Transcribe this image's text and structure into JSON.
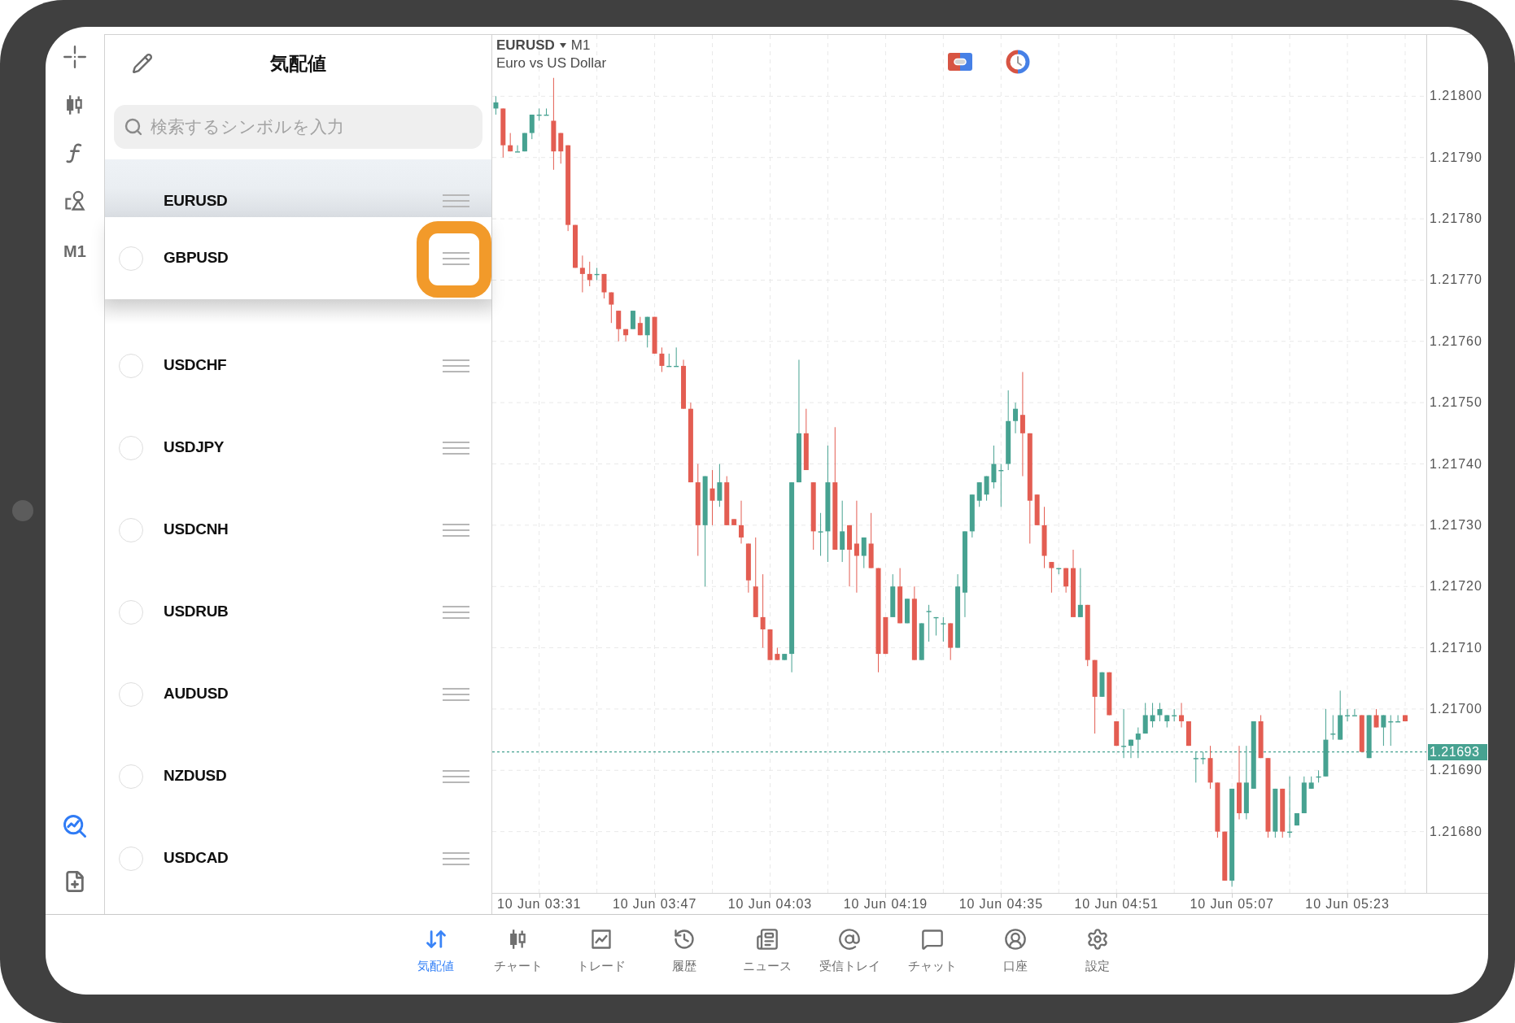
{
  "left_toolbar": {
    "timeframe": "M1"
  },
  "watchlist": {
    "title": "気配値",
    "search": {
      "placeholder": "検索するシンボルを入力"
    },
    "symbols": [
      {
        "name": "EURUSD",
        "kind": "fixed",
        "highlighted": false
      },
      {
        "name": "GBPUSD",
        "kind": "lifted",
        "checked": false,
        "highlighted": true
      },
      {
        "name": "USDCHF",
        "kind": "row",
        "checked": false,
        "highlighted": false
      },
      {
        "name": "USDJPY",
        "kind": "row",
        "checked": false,
        "highlighted": false
      },
      {
        "name": "USDCNH",
        "kind": "row",
        "checked": false,
        "highlighted": false
      },
      {
        "name": "USDRUB",
        "kind": "row",
        "checked": false,
        "highlighted": false
      },
      {
        "name": "AUDUSD",
        "kind": "row",
        "checked": false,
        "highlighted": false
      },
      {
        "name": "NZDUSD",
        "kind": "row",
        "checked": false,
        "highlighted": false
      },
      {
        "name": "USDCAD",
        "kind": "row",
        "checked": false,
        "highlighted": false
      }
    ]
  },
  "chart": {
    "symbol": "EURUSD",
    "timeframe": "M1",
    "description": "Euro vs US Dollar",
    "chart_data": {
      "type": "candlestick",
      "categories": [
        null,
        null,
        null,
        null,
        null,
        null,
        "10 Jun 03:31",
        null,
        null,
        null,
        null,
        null,
        null,
        null,
        null,
        null,
        null,
        null,
        null,
        null,
        null,
        null,
        "10 Jun 03:47",
        null,
        null,
        null,
        null,
        null,
        null,
        null,
        null,
        null,
        null,
        null,
        null,
        null,
        null,
        null,
        "10 Jun 04:03",
        null,
        null,
        null,
        null,
        null,
        null,
        null,
        null,
        null,
        null,
        null,
        null,
        null,
        null,
        null,
        "10 Jun 04:19",
        null,
        null,
        null,
        null,
        null,
        null,
        null,
        null,
        null,
        null,
        null,
        null,
        null,
        null,
        null,
        "10 Jun 04:35",
        null,
        null,
        null,
        null,
        null,
        null,
        null,
        null,
        null,
        null,
        null,
        null,
        null,
        null,
        null,
        "10 Jun 04:51",
        null,
        null,
        null,
        null,
        null,
        null,
        null,
        null,
        null,
        null,
        null,
        null,
        null,
        null,
        null,
        "10 Jun 05:07",
        null,
        null,
        null,
        null,
        null,
        null,
        null,
        null,
        null,
        null,
        null,
        null,
        null,
        null,
        null,
        "10 Jun 05:23",
        null,
        null,
        null,
        null,
        null,
        null,
        null,
        null,
        null,
        null,
        null,
        null,
        null,
        null,
        null,
        null,
        null,
        null,
        null
      ],
      "ohlc": [
        [
          1.21798,
          1.218,
          1.21797,
          1.21799
        ],
        [
          1.21798,
          1.21798,
          1.2179,
          1.21792
        ],
        [
          1.21792,
          1.21794,
          1.21791,
          1.21791
        ],
        [
          1.21791,
          1.21792,
          1.21791,
          1.21791
        ],
        [
          1.21791,
          1.21794,
          1.21791,
          1.21794
        ],
        [
          1.21794,
          1.21797,
          1.21793,
          1.21797
        ],
        [
          1.21797,
          1.21798,
          1.21796,
          1.21797
        ],
        [
          1.21797,
          1.21798,
          1.21797,
          1.21797
        ],
        [
          1.21796,
          1.21803,
          1.21788,
          1.21791
        ],
        [
          1.21794,
          1.21794,
          1.21789,
          1.21791
        ],
        [
          1.21792,
          1.21792,
          1.21778,
          1.21779
        ],
        [
          1.21779,
          1.21779,
          1.21772,
          1.21772
        ],
        [
          1.21772,
          1.21774,
          1.21768,
          1.21771
        ],
        [
          1.21771,
          1.21773,
          1.21769,
          1.2177
        ],
        [
          1.21771,
          1.21772,
          1.2177,
          1.21771
        ],
        [
          1.21771,
          1.21771,
          1.21767,
          1.21768
        ],
        [
          1.21768,
          1.21768,
          1.21763,
          1.21766
        ],
        [
          1.21765,
          1.21765,
          1.2176,
          1.21762
        ],
        [
          1.21762,
          1.21762,
          1.2176,
          1.21761
        ],
        [
          1.21762,
          1.21765,
          1.21762,
          1.21765
        ],
        [
          1.21763,
          1.21764,
          1.21761,
          1.21761
        ],
        [
          1.21761,
          1.21764,
          1.21759,
          1.21764
        ],
        [
          1.21764,
          1.21764,
          1.21758,
          1.21758
        ],
        [
          1.21758,
          1.21759,
          1.21755,
          1.21756
        ],
        [
          1.21756,
          1.21758,
          1.21756,
          1.21756
        ],
        [
          1.21756,
          1.21759,
          1.21756,
          1.21756
        ],
        [
          1.21756,
          1.21757,
          1.21749,
          1.21749
        ],
        [
          1.21749,
          1.2175,
          1.21737,
          1.21737
        ],
        [
          1.21737,
          1.2174,
          1.21725,
          1.2173
        ],
        [
          1.2173,
          1.21738,
          1.2172,
          1.21738
        ],
        [
          1.21736,
          1.21739,
          1.2173,
          1.21734
        ],
        [
          1.21734,
          1.2174,
          1.21733,
          1.21737
        ],
        [
          1.21737,
          1.21738,
          1.2173,
          1.2173
        ],
        [
          1.21731,
          1.21731,
          1.2173,
          1.2173
        ],
        [
          1.2173,
          1.21734,
          1.21727,
          1.21728
        ],
        [
          1.21727,
          1.21727,
          1.21719,
          1.21721
        ],
        [
          1.2172,
          1.21728,
          1.21715,
          1.21715
        ],
        [
          1.21715,
          1.21722,
          1.2171,
          1.21713
        ],
        [
          1.21713,
          1.21713,
          1.21708,
          1.21708
        ],
        [
          1.21709,
          1.2171,
          1.21708,
          1.21708
        ],
        [
          1.21708,
          1.21709,
          1.21708,
          1.21709
        ],
        [
          1.21709,
          1.21737,
          1.21706,
          1.21737
        ],
        [
          1.21737,
          1.21757,
          1.21737,
          1.21745
        ],
        [
          1.21745,
          1.21749,
          1.21739,
          1.21739
        ],
        [
          1.21737,
          1.21737,
          1.21726,
          1.21729
        ],
        [
          1.21729,
          1.21732,
          1.21725,
          1.21729
        ],
        [
          1.21729,
          1.21743,
          1.21724,
          1.21737
        ],
        [
          1.21737,
          1.21746,
          1.21726,
          1.21726
        ],
        [
          1.21726,
          1.21734,
          1.21724,
          1.21729
        ],
        [
          1.2173,
          1.2173,
          1.2172,
          1.21726
        ],
        [
          1.21727,
          1.21734,
          1.21719,
          1.21725
        ],
        [
          1.21725,
          1.21728,
          1.21723,
          1.21728
        ],
        [
          1.21727,
          1.21732,
          1.21723,
          1.21723
        ],
        [
          1.21723,
          1.21723,
          1.21706,
          1.21709
        ],
        [
          1.21715,
          1.21715,
          1.21709,
          1.21709
        ],
        [
          1.21715,
          1.21722,
          1.21715,
          1.2172
        ],
        [
          1.2172,
          1.21723,
          1.21714,
          1.21714
        ],
        [
          1.21714,
          1.21718,
          1.21714,
          1.21718
        ],
        [
          1.21718,
          1.2172,
          1.21708,
          1.21708
        ],
        [
          1.21708,
          1.21714,
          1.21708,
          1.21714
        ],
        [
          1.21716,
          1.21717,
          1.21711,
          1.21716
        ],
        [
          1.21715,
          1.21715,
          1.21712,
          1.21715
        ],
        [
          1.21714,
          1.21715,
          1.21711,
          1.21714
        ],
        [
          1.21714,
          1.21714,
          1.21708,
          1.2171
        ],
        [
          1.2171,
          1.21722,
          1.2171,
          1.2172
        ],
        [
          1.21719,
          1.21729,
          1.21715,
          1.21729
        ],
        [
          1.21729,
          1.21735,
          1.21728,
          1.21735
        ],
        [
          1.21734,
          1.21737,
          1.21733,
          1.21737
        ],
        [
          1.21735,
          1.21738,
          1.21734,
          1.21738
        ],
        [
          1.21737,
          1.21743,
          1.21736,
          1.2174
        ],
        [
          1.21739,
          1.2174,
          1.21733,
          1.21739
        ],
        [
          1.2174,
          1.21752,
          1.21739,
          1.21747
        ],
        [
          1.21747,
          1.2175,
          1.21745,
          1.21749
        ],
        [
          1.21748,
          1.21755,
          1.21738,
          1.21745
        ],
        [
          1.21745,
          1.21745,
          1.21727,
          1.21734
        ],
        [
          1.21735,
          1.21735,
          1.2173,
          1.2173
        ],
        [
          1.2173,
          1.21733,
          1.21723,
          1.21725
        ],
        [
          1.21724,
          1.21724,
          1.21719,
          1.21723
        ],
        [
          1.21723,
          1.21723,
          1.21722,
          1.21723
        ],
        [
          1.21723,
          1.21723,
          1.21719,
          1.2172
        ],
        [
          1.21723,
          1.21726,
          1.21715,
          1.21715
        ],
        [
          1.21715,
          1.21723,
          1.21715,
          1.21717
        ],
        [
          1.21717,
          1.21717,
          1.21707,
          1.21708
        ],
        [
          1.21708,
          1.21708,
          1.21696,
          1.21702
        ],
        [
          1.21702,
          1.21706,
          1.21702,
          1.21706
        ],
        [
          1.21706,
          1.21706,
          1.21699,
          1.21699
        ],
        [
          1.21698,
          1.21698,
          1.21694,
          1.21694
        ],
        [
          1.21694,
          1.217,
          1.21692,
          1.21694
        ],
        [
          1.21694,
          1.21695,
          1.21692,
          1.21695
        ],
        [
          1.21695,
          1.21697,
          1.21692,
          1.21696
        ],
        [
          1.21696,
          1.21701,
          1.21696,
          1.21699
        ],
        [
          1.21698,
          1.21701,
          1.21697,
          1.21699
        ],
        [
          1.21699,
          1.21701,
          1.21698,
          1.217
        ],
        [
          1.21698,
          1.21699,
          1.21697,
          1.21699
        ],
        [
          1.21699,
          1.217,
          1.21698,
          1.21699
        ],
        [
          1.21699,
          1.21701,
          1.21697,
          1.21698
        ],
        [
          1.21698,
          1.21698,
          1.21694,
          1.21694
        ],
        [
          1.21692,
          1.21693,
          1.21688,
          1.21692
        ],
        [
          1.21692,
          1.21693,
          1.21691,
          1.21692
        ],
        [
          1.21692,
          1.21694,
          1.21687,
          1.21688
        ],
        [
          1.21688,
          1.21688,
          1.21679,
          1.2168
        ],
        [
          1.2168,
          1.2168,
          1.21672,
          1.21672
        ],
        [
          1.21672,
          1.21687,
          1.21671,
          1.21687
        ],
        [
          1.21688,
          1.21694,
          1.21682,
          1.21683
        ],
        [
          1.21683,
          1.21694,
          1.21682,
          1.21688
        ],
        [
          1.21687,
          1.21698,
          1.21687,
          1.21698
        ],
        [
          1.21698,
          1.21699,
          1.21692,
          1.21692
        ],
        [
          1.21692,
          1.21692,
          1.21679,
          1.2168
        ],
        [
          1.2168,
          1.21687,
          1.21679,
          1.21687
        ],
        [
          1.21687,
          1.21687,
          1.21679,
          1.2168
        ],
        [
          1.2168,
          1.21689,
          1.21679,
          1.2168
        ],
        [
          1.21681,
          1.21683,
          1.21681,
          1.21683
        ],
        [
          1.21683,
          1.21689,
          1.21683,
          1.21688
        ],
        [
          1.21687,
          1.21689,
          1.21687,
          1.21688
        ],
        [
          1.21689,
          1.2169,
          1.21688,
          1.21689
        ],
        [
          1.21689,
          1.217,
          1.21689,
          1.21695
        ],
        [
          1.21696,
          1.21699,
          1.21695,
          1.21696
        ],
        [
          1.21695,
          1.21703,
          1.21695,
          1.21699
        ],
        [
          1.21699,
          1.217,
          1.21698,
          1.21699
        ],
        [
          1.21699,
          1.217,
          1.21699,
          1.21699
        ],
        [
          1.21699,
          1.21699,
          1.21693,
          1.21693
        ],
        [
          1.21692,
          1.21699,
          1.21692,
          1.21699
        ],
        [
          1.21699,
          1.217,
          1.21697,
          1.21697
        ],
        [
          1.21697,
          1.21699,
          1.21694,
          1.21699
        ],
        [
          1.21698,
          1.21699,
          1.21694,
          1.21698
        ],
        [
          1.21698,
          1.21699,
          1.21698,
          1.21698
        ],
        [
          1.21699,
          1.21699,
          1.21698,
          1.21698
        ],
        null,
        null,
        null,
        null,
        null,
        null,
        null,
        null,
        null,
        null,
        null
      ],
      "ylim": [
        1.2167,
        1.2181
      ],
      "grid": true,
      "yticks": [
        {
          "value": 1.218,
          "label": "1.21800"
        },
        {
          "value": 1.2179,
          "label": "1.21790"
        },
        {
          "value": 1.2178,
          "label": "1.21780"
        },
        {
          "value": 1.2177,
          "label": "1.21770"
        },
        {
          "value": 1.2176,
          "label": "1.21760"
        },
        {
          "value": 1.2175,
          "label": "1.21750"
        },
        {
          "value": 1.2174,
          "label": "1.21740"
        },
        {
          "value": 1.2173,
          "label": "1.21730"
        },
        {
          "value": 1.2172,
          "label": "1.21720"
        },
        {
          "value": 1.2171,
          "label": "1.21710"
        },
        {
          "value": 1.217,
          "label": "1.21700"
        },
        {
          "value": 1.2169,
          "label": "1.21690"
        },
        {
          "value": 1.2168,
          "label": "1.21680"
        }
      ],
      "ref_lines": [
        {
          "axis": "y",
          "value": 1.21693,
          "label": "1.21693"
        }
      ]
    }
  },
  "tab_bar": {
    "tabs": [
      {
        "label": "気配値",
        "selected": true
      },
      {
        "label": "チャート",
        "selected": false
      },
      {
        "label": "トレード",
        "selected": false
      },
      {
        "label": "履歴",
        "selected": false
      },
      {
        "label": "ニュース",
        "selected": false
      },
      {
        "label": "受信トレイ",
        "selected": false
      },
      {
        "label": "チャット",
        "selected": false
      },
      {
        "label": "口座",
        "selected": false
      },
      {
        "label": "設定",
        "selected": false
      }
    ]
  }
}
